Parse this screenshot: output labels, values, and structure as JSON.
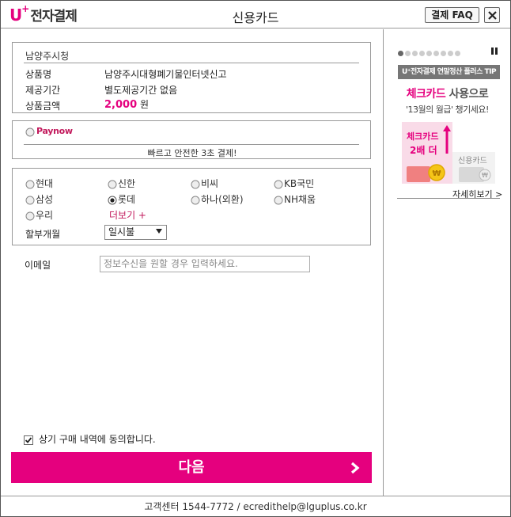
{
  "header": {
    "logo_u": "U",
    "logo_plus": "+",
    "logo_text": "전자결제",
    "title": "신용카드",
    "faq_label": "결제 FAQ"
  },
  "order": {
    "shop_name": "남양주시청",
    "product_label": "상품명",
    "product_value": "남양주시대형폐기물인터넷신고",
    "period_label": "제공기간",
    "period_value": "별도제공기간 없음",
    "amount_label": "상품금액",
    "amount_value": "2,000",
    "amount_unit": "원"
  },
  "paynow": {
    "logo": "Paynow",
    "description": "빠르고 안전한 3초 결제!"
  },
  "cards": {
    "options": [
      "현대",
      "신한",
      "비씨",
      "KB국민",
      "삼성",
      "롯데",
      "하나(외환)",
      "NH채움",
      "우리"
    ],
    "selected": "롯데",
    "more_label": "더보기 +",
    "installment_label": "할부개월",
    "installment_value": "일시불"
  },
  "email": {
    "label": "이메일",
    "placeholder": "정보수신을 원할 경우 입력하세요."
  },
  "agreement": {
    "label": "상기 구매 내역에 동의합니다.",
    "checked": true
  },
  "next_button": {
    "label": "다음"
  },
  "banner": {
    "slide_count": 9,
    "active_slide": 1,
    "tip_title": "U⁺전자결제 연말정산 플러스 TIP",
    "line1_pink": "체크카드",
    "line1_rest": " 사용으로",
    "line2": "'13월의 월급' 챙기세요!",
    "check_card_label": "체크카드",
    "check_card_badge": "2배 더",
    "credit_card_label": "신용카드",
    "detail_link": "자세히보기 >"
  },
  "footer": {
    "text": "고객센터 1544-7772 / ecredithelp@lguplus.co.kr"
  },
  "colors": {
    "brand": "#e5007e",
    "border": "#999999",
    "banner_bar": "#767676"
  }
}
